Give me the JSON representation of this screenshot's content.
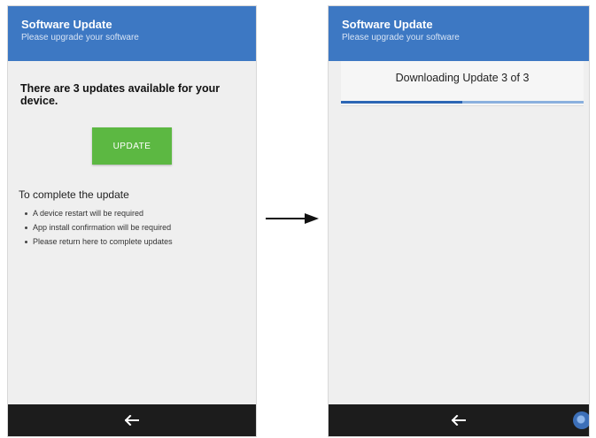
{
  "left_screen": {
    "header": {
      "title": "Software Update",
      "subtitle": "Please upgrade your software"
    },
    "headline": "There are 3 updates available for your device.",
    "update_button": "UPDATE",
    "complete_heading": "To complete the update",
    "bullets": [
      "A device restart will be required",
      "App install confirmation will be required",
      "Please return here to complete updates"
    ],
    "nav": {
      "back_icon": "arrow-left-icon"
    }
  },
  "right_screen": {
    "header": {
      "title": "Software Update",
      "subtitle": "Please upgrade your software"
    },
    "progress_text": "Downloading Update 3 of 3",
    "progress_fraction": 0.5,
    "nav": {
      "back_icon": "arrow-left-icon",
      "assist_icon": "assistant-circle-icon"
    }
  },
  "transition_icon": "arrow-right-icon",
  "colors": {
    "header_blue": "#3d78c3",
    "button_green": "#5cb842",
    "nav_bar": "#1c1c1c",
    "progress_fill": "#2c66b5"
  }
}
